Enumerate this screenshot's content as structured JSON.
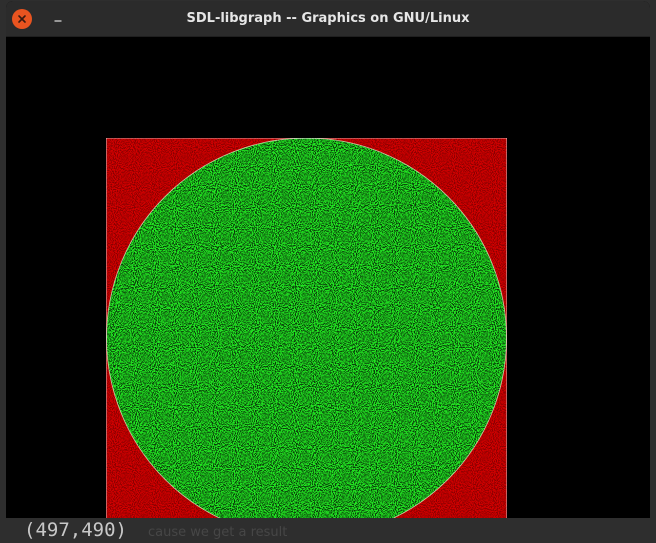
{
  "window": {
    "title": "SDL-libgraph -- Graphics on GNU/Linux",
    "close_icon": "close-icon",
    "minimize_icon": "minimize-icon"
  },
  "scene": {
    "description_colors": {
      "outside_fill": "#d10000",
      "inside_fill": "#22e622",
      "background": "#000000",
      "points_gap": "#000000"
    }
  },
  "status": {
    "coords": "(497,490)",
    "faint_text": "cause we get a result"
  }
}
